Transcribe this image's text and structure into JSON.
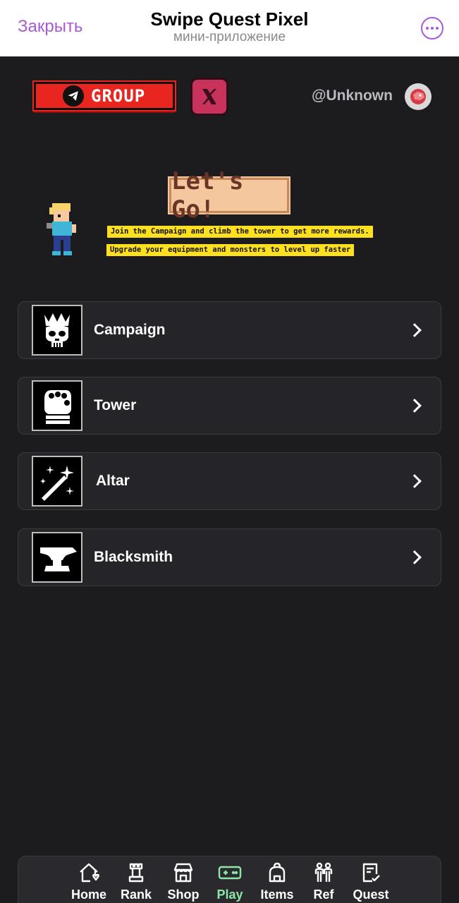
{
  "topbar": {
    "close_label": "Закрыть",
    "title": "Swipe Quest Pixel",
    "subtitle": "мини-приложение"
  },
  "header": {
    "group_label": "GROUP",
    "x_icon": "x-logo-icon",
    "username": "@Unknown",
    "avatar_icon": "dragon-avatar-icon"
  },
  "banner": {
    "headline": "Let's Go!",
    "tips": [
      "Join the Campaign and climb the tower to get more rewards.",
      "Upgrade your equipment and monsters to level up faster"
    ]
  },
  "menu": {
    "items": [
      {
        "label": "Campaign",
        "icon": "crowned-skull-icon"
      },
      {
        "label": "Tower",
        "icon": "gauntlet-fist-icon"
      },
      {
        "label": "Altar",
        "icon": "magic-wand-icon"
      },
      {
        "label": "Blacksmith",
        "icon": "anvil-icon"
      }
    ]
  },
  "nav": {
    "active": "Play",
    "items": [
      {
        "label": "Home",
        "icon": "home-icon"
      },
      {
        "label": "Rank",
        "icon": "chess-rook-icon"
      },
      {
        "label": "Shop",
        "icon": "shop-icon"
      },
      {
        "label": "Play",
        "icon": "gamepad-icon"
      },
      {
        "label": "Items",
        "icon": "backpack-icon"
      },
      {
        "label": "Ref",
        "icon": "friends-icon"
      },
      {
        "label": "Quest",
        "icon": "checklist-icon"
      }
    ]
  },
  "colors": {
    "accent_purple": "#a85ad8",
    "group_red": "#e8261f",
    "active_green": "#8de6a8",
    "tip_yellow": "#ffe01e",
    "background": "#1c1c1f"
  }
}
